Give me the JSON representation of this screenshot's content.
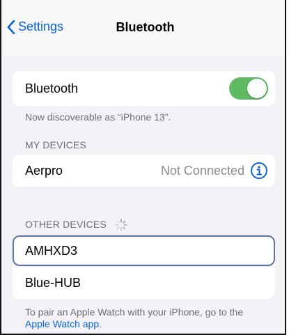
{
  "navbar": {
    "back_label": "Settings",
    "title": "Bluetooth"
  },
  "bluetooth_toggle": {
    "label": "Bluetooth",
    "state": "on",
    "on_color": "#5fba63"
  },
  "discoverable_text": "Now discoverable as “iPhone 13”.",
  "my_devices": {
    "header": "MY DEVICES",
    "items": [
      {
        "name": "Aerpro",
        "status": "Not Connected",
        "icon": "info-icon"
      }
    ]
  },
  "other_devices": {
    "header": "OTHER DEVICES",
    "spinner_icon": "activity-spinner-icon",
    "items": [
      {
        "name": "AMHXD3",
        "highlighted": true
      },
      {
        "name": "Blue-HUB",
        "highlighted": false
      }
    ]
  },
  "footer": {
    "text": "To pair an Apple Watch with your iPhone, go to the",
    "link": "Apple Watch app",
    "suffix": "."
  },
  "colors": {
    "accent": "#0a63d8",
    "highlight_border": "#5b74a8",
    "background": "#f2f2f7"
  }
}
